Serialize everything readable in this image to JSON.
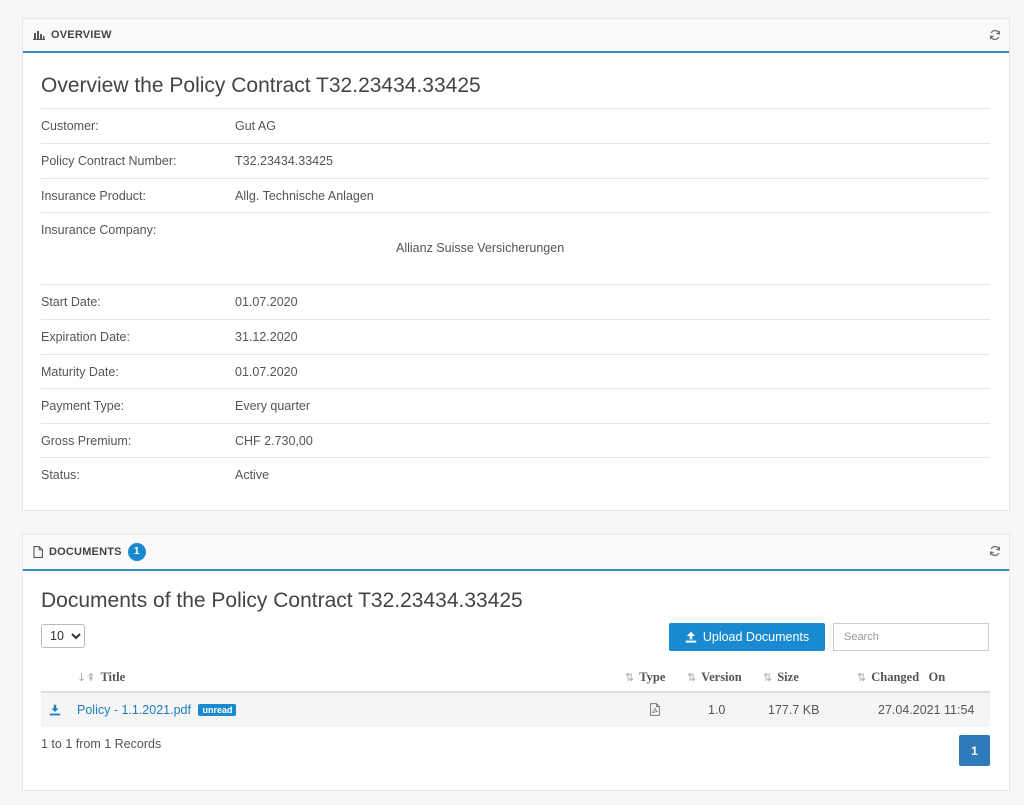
{
  "overview": {
    "header": "OVERVIEW",
    "heading": "Overview the Policy Contract T32.23434.33425",
    "fields": {
      "customer": {
        "label": "Customer:",
        "value": "Gut AG"
      },
      "contract_number": {
        "label": "Policy Contract Number:",
        "value": "T32.23434.33425"
      },
      "product": {
        "label": "Insurance Product:",
        "value": "Allg. Technische Anlagen"
      },
      "company": {
        "label": "Insurance Company:",
        "value": "Allianz Suisse Versicherungen"
      },
      "start_date": {
        "label": "Start Date:",
        "value": "01.07.2020"
      },
      "expiration_date": {
        "label": "Expiration Date:",
        "value": "31.12.2020"
      },
      "maturity_date": {
        "label": "Maturity Date:",
        "value": "01.07.2020"
      },
      "payment_type": {
        "label": "Payment Type:",
        "value": "Every quarter"
      },
      "gross_premium": {
        "label": "Gross Premium:",
        "value": "CHF 2.730,00"
      },
      "status": {
        "label": "Status:",
        "value": "Active"
      }
    }
  },
  "documents": {
    "header": "DOCUMENTS",
    "count": "1",
    "heading": "Documents of the Policy Contract T32.23434.33425",
    "page_length": "10",
    "upload_label": "Upload Documents",
    "search_placeholder": "Search",
    "columns": {
      "title": "Title",
      "type": "Type",
      "version": "Version",
      "size": "Size",
      "changed_on": "Changed   On"
    },
    "rows": [
      {
        "title": "Policy - 1.1.2021.pdf",
        "badge": "unread",
        "type_icon": "pdf-file-icon",
        "version": "1.0",
        "size": "177.7 KB",
        "changed_on": "27.04.2021 11:54"
      }
    ],
    "records_info": "1 to 1 from 1 Records",
    "current_page": "1"
  },
  "colors": {
    "accent": "#1a8ad0",
    "header_border": "#3a8ec8",
    "pager": "#2f7ab8"
  }
}
